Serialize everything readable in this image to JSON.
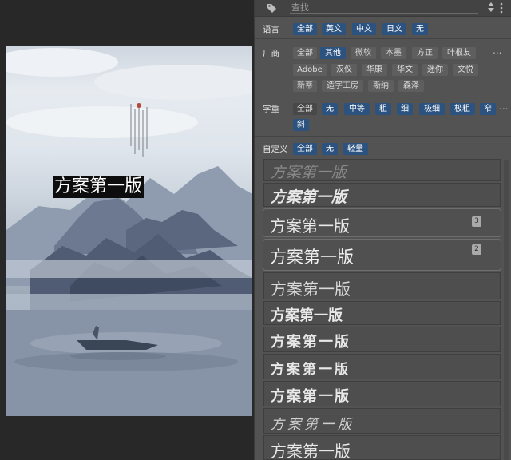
{
  "canvas": {
    "selected_text": "方案第一版"
  },
  "search": {
    "placeholder": "查找"
  },
  "rows": {
    "language": {
      "label": "语言",
      "chips": [
        "全部",
        "英文",
        "中文",
        "日文",
        "无"
      ]
    },
    "vendor": {
      "label": "厂商",
      "chips": [
        "全部",
        "其他",
        "微软",
        "本墨",
        "方正",
        "叶根友",
        "Adobe",
        "汉仪",
        "华康",
        "华文",
        "迷你",
        "文悦",
        "新蒂",
        "造字工房",
        "斯纳",
        "森泽"
      ],
      "more": "..."
    },
    "weight": {
      "label": "字重",
      "chips": [
        "全部",
        "无",
        "中等",
        "粗",
        "细",
        "极细",
        "极粗",
        "窄",
        "斜"
      ],
      "more": "..."
    },
    "custom": {
      "label": "自定义",
      "chips": [
        "全部",
        "无",
        "轻量"
      ]
    }
  },
  "font_list": [
    {
      "text": "方案第一版"
    },
    {
      "text": "方案第一版"
    },
    {
      "text": "方案第一版",
      "badge": "3"
    },
    {
      "text": "方案第一版",
      "badge": "2"
    },
    {
      "text": "方案第一版"
    },
    {
      "text": "方案第一版"
    },
    {
      "text": "方案第一版"
    },
    {
      "text": "方案第一版"
    },
    {
      "text": "方案第一版"
    },
    {
      "text": "方案第一版"
    },
    {
      "text": "方案第一版"
    }
  ],
  "colors": {
    "chip_selected": "#2c5380",
    "panel_bg": "#535353",
    "app_bg": "#282828"
  },
  "icons": [
    "tag-icon",
    "up-down-arrows-icon",
    "more-vertical-icon"
  ]
}
